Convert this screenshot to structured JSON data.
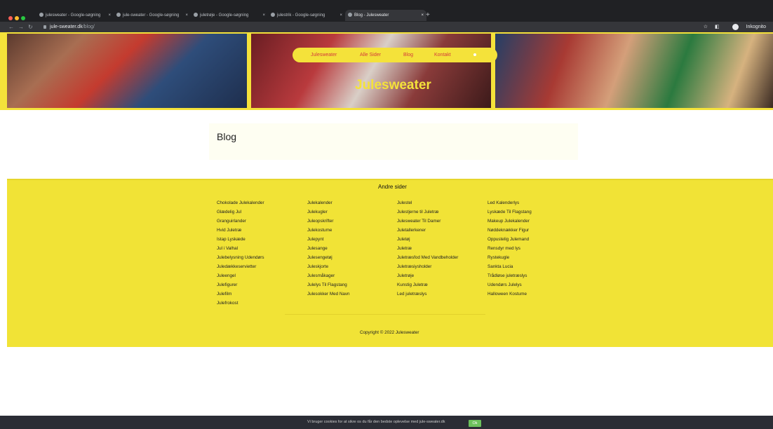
{
  "browser": {
    "tabs": [
      {
        "label": "julesweater - Google-søgning"
      },
      {
        "label": "jule-sweater - Google-søgning"
      },
      {
        "label": "juletrøje - Google-søgning"
      },
      {
        "label": "julestrik - Google-søgning"
      },
      {
        "label": "Blog - Julesweater"
      }
    ],
    "url_host": "jule-sweater.dk",
    "url_path": "/blog/",
    "profile_label": "Inkognito"
  },
  "site": {
    "nav": [
      "Julesweater",
      "Alle Sider",
      "Blog",
      "Kontakt"
    ],
    "hero_title": "Julesweater",
    "page_title": "Blog"
  },
  "footer": {
    "heading": "Andre sider",
    "columns": [
      [
        "Chokolade Julekalender",
        "Glædelig Jul",
        "Granguirlander",
        "Hvid Juletræ",
        "Istap Lyskæde",
        "Jul i Valhal",
        "Julebelysning Udendørs",
        "Juledækkeservietter",
        "Juleengel",
        "Julefigurer",
        "Julefilm",
        "Julefrokost"
      ],
      [
        "Julekalender",
        "Julekugler",
        "Juleopskrifter",
        "Julekostume",
        "Julepynt",
        "Julesange",
        "Julesengetøj",
        "Juleskjorte",
        "Julesmåkager",
        "Julelys Til Flagstang",
        "Julesokker Med Navn"
      ],
      [
        "Julestel",
        "Julestjerne til Juletræ",
        "Julesweater Til Damer",
        "Juletallerkener",
        "Juletøj",
        "Juletræ",
        "Juletræsfod Med Vandbeholder",
        "Juletræsiysholder",
        "Juletrøje",
        "Kunstig Juletræ",
        "Led juletræslys"
      ],
      [
        "Led Kalenderlys",
        "Lyskæde Til Flagstang",
        "Makeup Julekalender",
        "Nøddeknækker Figur",
        "Oppustelig Julemand",
        "Rensdyr med lys",
        "Rystekugle",
        "Sankta Lucia",
        "Trådløse juletræslys",
        "Udendørs Julelys",
        "Halloween Kostume"
      ]
    ],
    "copyright": "Copyright © 2022 Julesweater"
  },
  "cookie": {
    "text": "Vi bruger cookies for at sikre os du får den bedste oplevelse med jule-sweater.dk",
    "ok_label": "Ok"
  }
}
